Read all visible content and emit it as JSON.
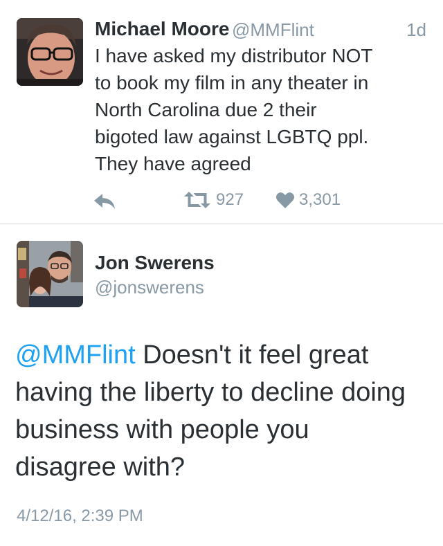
{
  "tweet1": {
    "author_name": "Michael Moore",
    "author_handle": "@MMFlint",
    "time_ago": "1d",
    "text_lines": [
      "I have asked my distributor NOT",
      "to book my film in any theater in",
      "North Carolina due 2 their",
      "bigoted law against LGBTQ ppl.",
      "They have agreed"
    ],
    "retweet_count": "927",
    "like_count": "3,301"
  },
  "tweet2": {
    "author_name": "Jon Swerens",
    "author_handle": "@jonswerens",
    "mention": "@MMFlint",
    "text_lines": [
      " Doesn't it feel great",
      "having the liberty to decline doing",
      "business with people you",
      "disagree with?"
    ],
    "timestamp": "4/12/16, 2:39 PM"
  },
  "colors": {
    "text": "#292f33",
    "secondary": "#8899a6",
    "link": "#1da1f2",
    "divider": "#d8dde1"
  }
}
